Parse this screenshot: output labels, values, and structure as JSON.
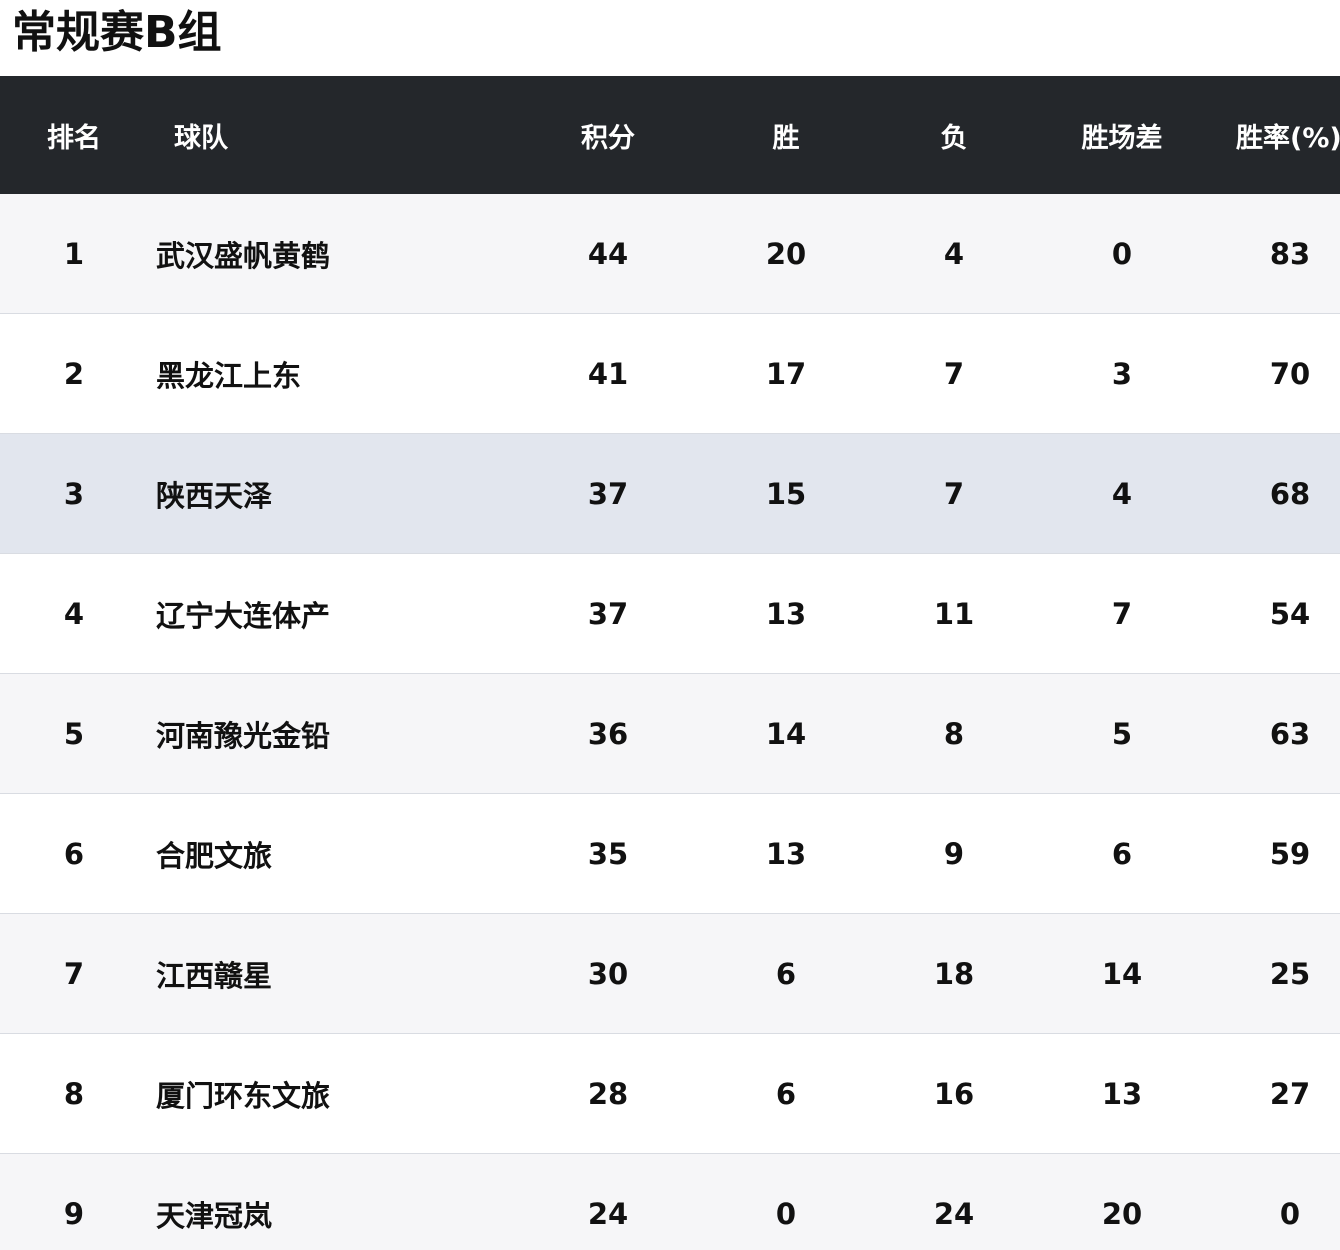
{
  "title": "常规赛B组",
  "header": {
    "rank": "排名",
    "team": "球队",
    "points": "积分",
    "wins": "胜",
    "losses": "负",
    "games_behind": "胜场差",
    "win_rate": "胜率(%)"
  },
  "rows": [
    {
      "rank": "1",
      "team": "武汉盛帆黄鹤",
      "points": "44",
      "wins": "20",
      "losses": "4",
      "games_behind": "0",
      "win_rate": "83"
    },
    {
      "rank": "2",
      "team": "黑龙江上东",
      "points": "41",
      "wins": "17",
      "losses": "7",
      "games_behind": "3",
      "win_rate": "70"
    },
    {
      "rank": "3",
      "team": "陕西天泽",
      "points": "37",
      "wins": "15",
      "losses": "7",
      "games_behind": "4",
      "win_rate": "68"
    },
    {
      "rank": "4",
      "team": "辽宁大连体产",
      "points": "37",
      "wins": "13",
      "losses": "11",
      "games_behind": "7",
      "win_rate": "54"
    },
    {
      "rank": "5",
      "team": "河南豫光金铅",
      "points": "36",
      "wins": "14",
      "losses": "8",
      "games_behind": "5",
      "win_rate": "63"
    },
    {
      "rank": "6",
      "team": "合肥文旅",
      "points": "35",
      "wins": "13",
      "losses": "9",
      "games_behind": "6",
      "win_rate": "59"
    },
    {
      "rank": "7",
      "team": "江西赣星",
      "points": "30",
      "wins": "6",
      "losses": "18",
      "games_behind": "14",
      "win_rate": "25"
    },
    {
      "rank": "8",
      "team": "厦门环东文旅",
      "points": "28",
      "wins": "6",
      "losses": "16",
      "games_behind": "13",
      "win_rate": "27"
    },
    {
      "rank": "9",
      "team": "天津冠岚",
      "points": "24",
      "wins": "0",
      "losses": "24",
      "games_behind": "20",
      "win_rate": "0"
    }
  ],
  "colors": {
    "header_bg": "#24272b",
    "highlight_row": "#e2e6ee",
    "alt_row": "#f6f6f8"
  }
}
